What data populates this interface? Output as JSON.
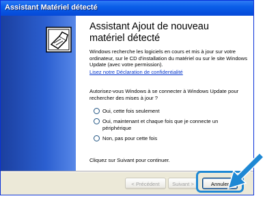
{
  "window": {
    "title": "Assistant Matériel détecté"
  },
  "wizard": {
    "heading": "Assistant Ajout de nouveau matériel détecté",
    "intro": "Windows recherche les logiciels en cours et mis à jour sur votre ordinateur, sur le CD d'installation du matériel ou sur le site Windows Update (avec votre permission).",
    "privacy_link": "Lisez notre Déclaration de confidentialité",
    "question": "Autorisez-vous Windows à se connecter à Windows Update pour rechercher des mises à jour ?",
    "options": [
      {
        "label": "Oui, cette fois seulement"
      },
      {
        "label": "Oui, maintenant et chaque fois que je connecte un périphérique"
      },
      {
        "label": "Non, pas pour cette fois"
      }
    ],
    "footer_text": "Cliquez sur Suivant pour continuer."
  },
  "buttons": {
    "back": "< Précédent",
    "next": "Suivant >",
    "cancel": "Annuler"
  },
  "colors": {
    "highlight": "#1e88d4",
    "title_bar": "#0a5ee8"
  },
  "icons": {
    "wizard": "hardware-wizard-icon",
    "arrow": "pointer-arrow-icon"
  }
}
